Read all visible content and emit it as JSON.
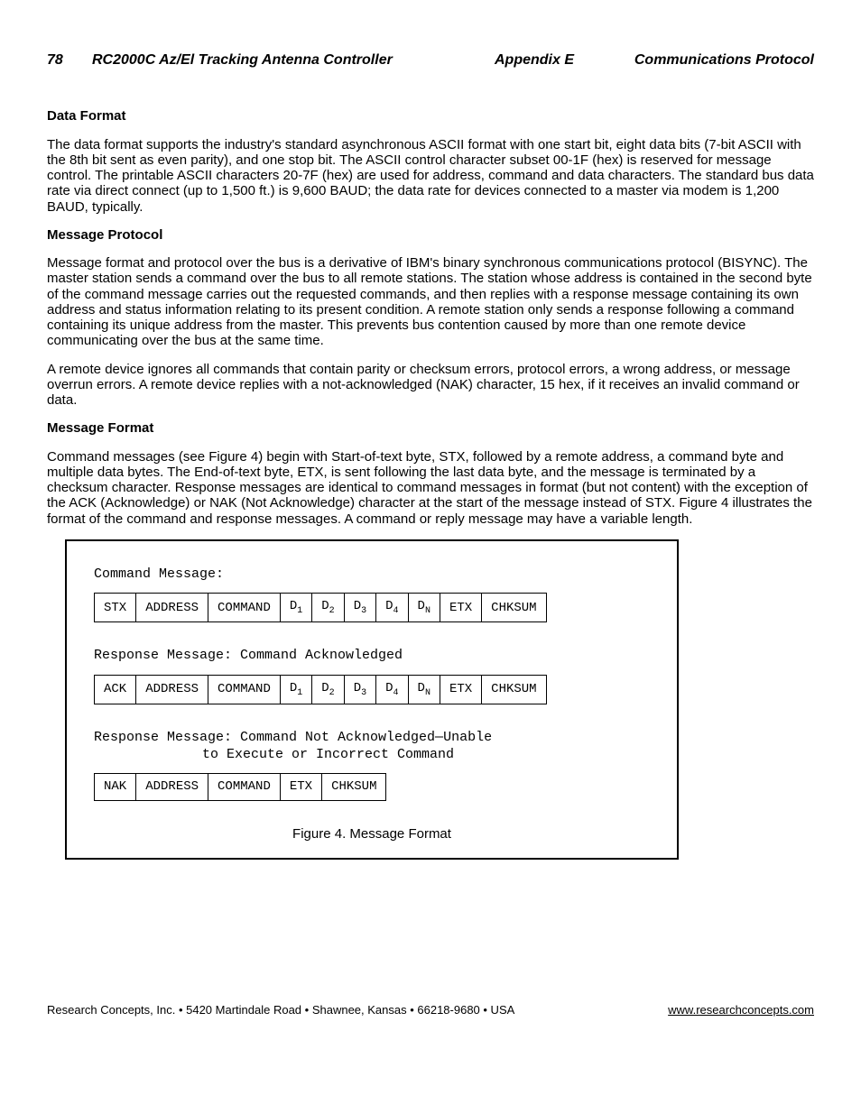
{
  "header": {
    "page": "78",
    "title": "RC2000C Az/El Tracking Antenna Controller",
    "center": "Appendix E",
    "right": "Communications Protocol"
  },
  "s1": {
    "heading": "Data Format",
    "p1": "The data format supports the industry's standard asynchronous ASCII format with one start bit, eight data bits (7-bit ASCII with the 8th bit sent as even parity), and one stop bit.  The ASCII control character subset 00-1F (hex) is reserved for message control.  The printable ASCII characters 20-7F (hex) are used for address, command and data characters.  The standard bus data rate via direct connect (up to 1,500 ft.) is 9,600 BAUD; the data rate for devices connected to a master via modem is 1,200 BAUD, typically."
  },
  "s2": {
    "heading": "Message Protocol",
    "p1": "Message format and protocol over the bus is a derivative of IBM's binary synchronous communications protocol (BISYNC).  The master station sends a command over the bus to all remote stations.  The station whose address is contained in the second byte of the command message carries out the requested commands, and then replies with a response message containing its own address and status information relating to its present condition.  A remote station only sends a response following a command containing its unique address from the master.  This prevents bus contention caused by more than one remote device communicating over the bus at the same time.",
    "p2": "A remote device ignores all commands that contain parity or checksum errors, protocol errors, a wrong address, or message overrun errors.  A remote device replies with a not-acknowledged (NAK) character, 15 hex, if it receives an invalid command or data."
  },
  "s3": {
    "heading": "Message Format",
    "p1": "Command messages (see Figure 4) begin with Start-of-text byte, STX, followed by a remote address, a command byte and multiple data bytes.  The End-of-text byte, ETX, is sent following the last data byte, and the message is terminated by a checksum character.  Response messages are identical to command messages in format (but not content) with the exception of the ACK (Acknowledge) or NAK (Not Acknowledge) character at the start of the message instead of STX.  Figure 4 illustrates the format of the command and response messages.  A command or reply message may have a variable length."
  },
  "fig": {
    "cmd_label": "Command Message:",
    "ack_label": "Response Message: Command Acknowledged",
    "nak_label1": "Response Message: Command Not Acknowledged—Unable",
    "nak_label2": "to Execute or Incorrect Command",
    "cells": {
      "stx": "STX",
      "ack": "ACK",
      "nak": "NAK",
      "addr": "ADDRESS",
      "cmd": "COMMAND",
      "d1a": "D",
      "d1b": "1",
      "d2a": "D",
      "d2b": "2",
      "d3a": "D",
      "d3b": "3",
      "d4a": "D",
      "d4b": "4",
      "dna": "D",
      "dnb": "N",
      "etx": "ETX",
      "chk": "CHKSUM"
    },
    "caption": "Figure 4.  Message Format"
  },
  "footer": {
    "left": "Research Concepts, Inc. • 5420 Martindale Road • Shawnee, Kansas • 66218-9680 • USA",
    "right": "www.researchconcepts.com"
  }
}
